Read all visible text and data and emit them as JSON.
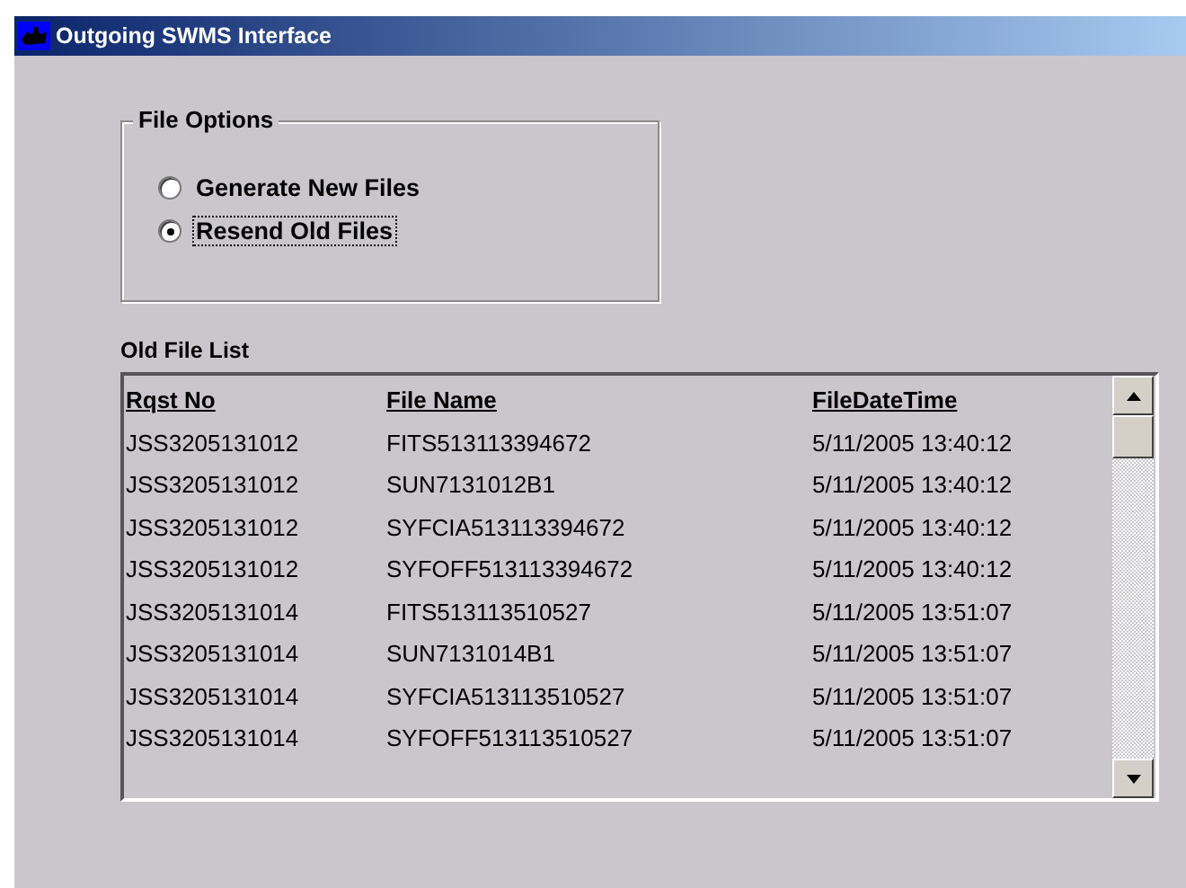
{
  "window": {
    "title": "Outgoing SWMS Interface"
  },
  "file_options": {
    "title": "File Options",
    "options": [
      {
        "label": "Generate New Files",
        "selected": false
      },
      {
        "label": "Resend Old Files",
        "selected": true
      }
    ]
  },
  "old_file_list": {
    "title": "Old File List",
    "columns": [
      "Rqst No",
      "File Name",
      "FileDateTime"
    ],
    "rows": [
      [
        "JSS3205131012",
        "FITS513113394672",
        "5/11/2005 13:40:12"
      ],
      [
        "JSS3205131012",
        "SUN7131012B1",
        "5/11/2005 13:40:12"
      ],
      [
        "JSS3205131012",
        "SYFCIA513113394672",
        "5/11/2005 13:40:12"
      ],
      [
        "JSS3205131012",
        "SYFOFF513113394672",
        "5/11/2005 13:40:12"
      ],
      [
        "JSS3205131014",
        "FITS513113510527",
        "5/11/2005 13:51:07"
      ],
      [
        "JSS3205131014",
        "SUN7131014B1",
        "5/11/2005 13:51:07"
      ],
      [
        "JSS3205131014",
        "SYFCIA513113510527",
        "5/11/2005 13:51:07"
      ],
      [
        "JSS3205131014",
        "SYFOFF513113510527",
        "5/11/2005 13:51:07"
      ]
    ]
  }
}
